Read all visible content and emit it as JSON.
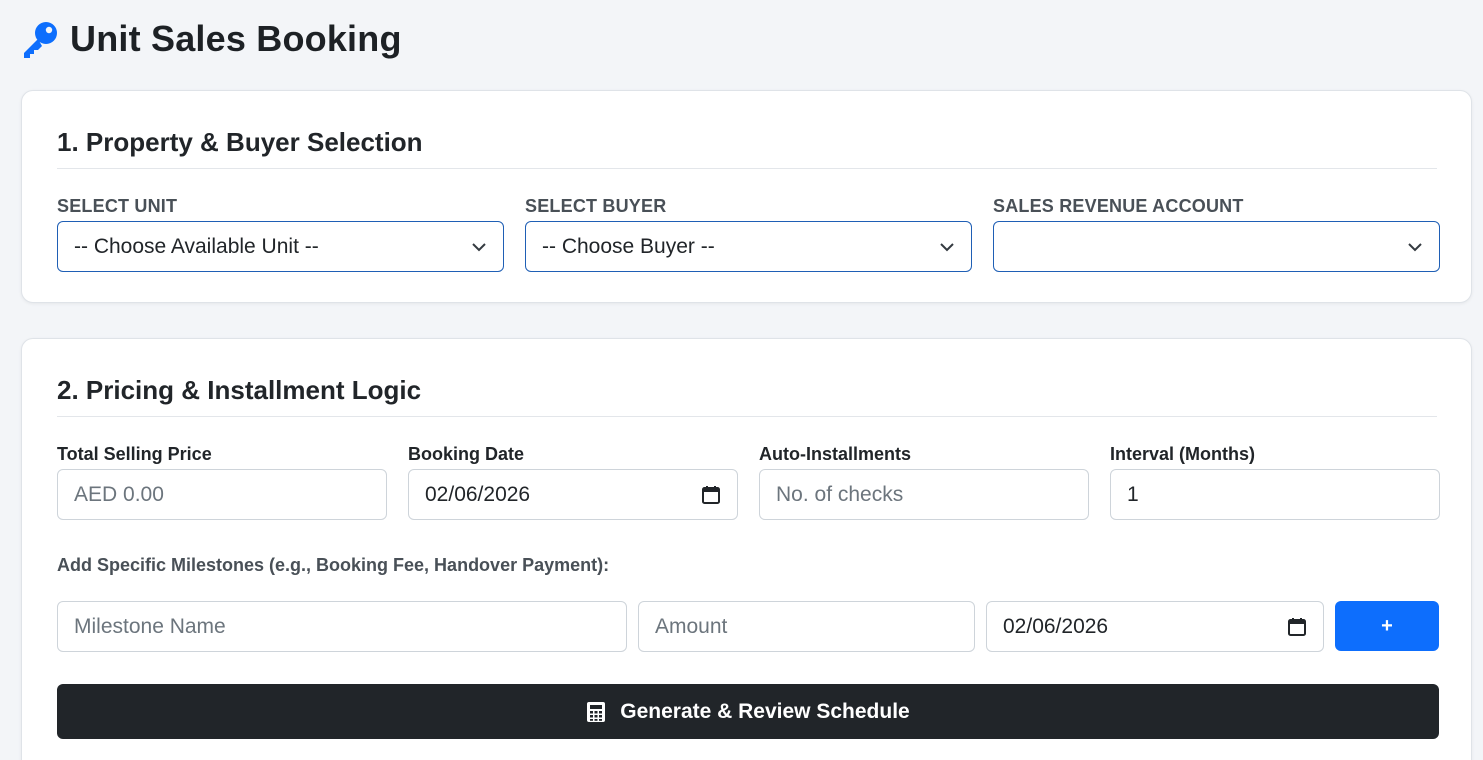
{
  "page": {
    "title": "Unit Sales Booking",
    "title_icon": "key-icon"
  },
  "section1": {
    "title": "1. Property & Buyer Selection",
    "unit": {
      "label": "SELECT UNIT",
      "selected": "-- Choose Available Unit --"
    },
    "buyer": {
      "label": "SELECT BUYER",
      "selected": "-- Choose Buyer --"
    },
    "revenue_account": {
      "label": "SALES REVENUE ACCOUNT",
      "selected": ""
    }
  },
  "section2": {
    "title": "2. Pricing & Installment Logic",
    "price": {
      "label": "Total Selling Price",
      "placeholder": "AED 0.00"
    },
    "booking_date": {
      "label": "Booking Date",
      "value": "02/06/2026"
    },
    "auto_installments": {
      "label": "Auto-Installments",
      "placeholder": "No. of checks"
    },
    "interval": {
      "label": "Interval (Months)",
      "value": "1"
    },
    "milestones": {
      "label": "Add Specific Milestones (e.g., Booking Fee, Handover Payment):",
      "name_placeholder": "Milestone Name",
      "amount_placeholder": "Amount",
      "date_value": "02/06/2026",
      "add_label": "+"
    },
    "generate_label": "Generate & Review Schedule"
  },
  "colors": {
    "primary": "#0d6efd",
    "dark": "#212529",
    "key_icon": "#0d6efd"
  }
}
